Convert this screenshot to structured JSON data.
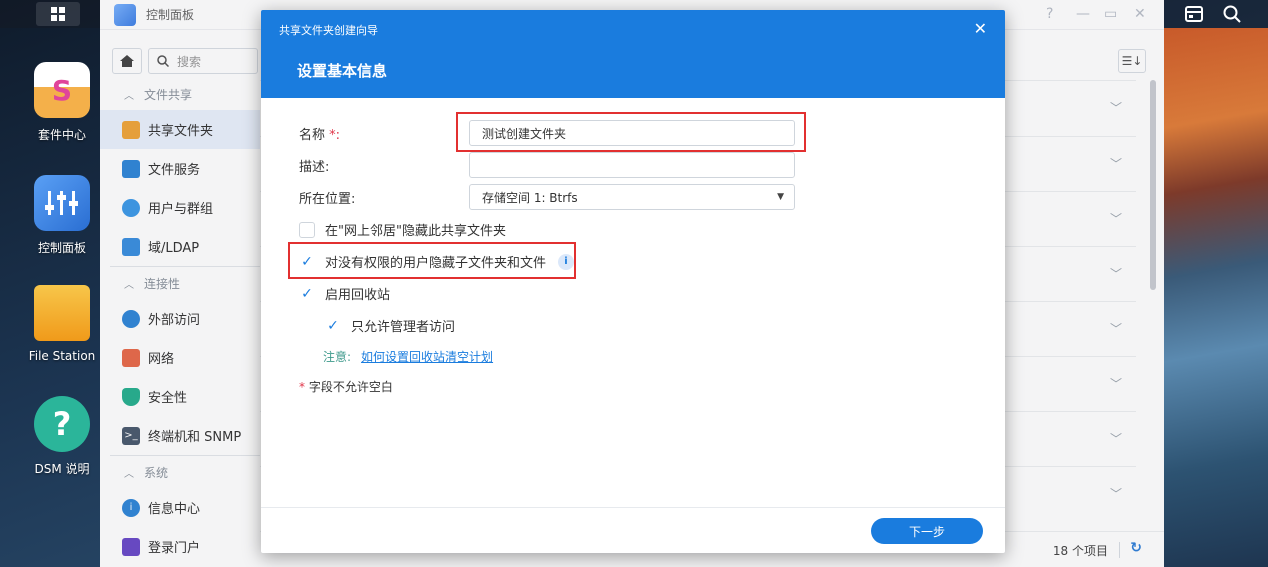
{
  "desktop": {
    "icons": [
      {
        "label": "套件中心",
        "icon": "package-center-icon"
      },
      {
        "label": "控制面板",
        "icon": "control-panel-icon"
      },
      {
        "label": "File Station",
        "icon": "folder-icon"
      },
      {
        "label": "DSM 说明",
        "icon": "help-icon"
      }
    ]
  },
  "control_panel": {
    "title": "控制面板",
    "search_placeholder": "搜索",
    "sections": [
      {
        "header": "文件共享",
        "items": [
          "共享文件夹",
          "文件服务",
          "用户与群组",
          "域/LDAP"
        ]
      },
      {
        "header": "连接性",
        "items": [
          "外部访问",
          "网络",
          "安全性",
          "终端机和 SNMP"
        ]
      },
      {
        "header": "系统",
        "items": [
          "信息中心",
          "登录门户"
        ]
      }
    ],
    "status": {
      "count": "18 个项目"
    }
  },
  "dialog": {
    "window_title": "共享文件夹创建向导",
    "step_title": "设置基本信息",
    "name_label": "名称",
    "name_required_mark": "*:",
    "name_value": "测试创建文件夹",
    "desc_label": "描述:",
    "desc_value": "",
    "location_label": "所在位置:",
    "location_value": "存储空间 1:  Btrfs",
    "cb_hide_network": "在\"网上邻居\"隐藏此共享文件夹",
    "cb_hide_subfolders": "对没有权限的用户隐藏子文件夹和文件",
    "cb_recycle_bin": "启用回收站",
    "cb_admin_only": "只允许管理者访问",
    "note_label": "注意:",
    "note_link": "如何设置回收站清空计划",
    "required_note_mark": "*",
    "required_note": "字段不允许空白",
    "next_button": "下一步"
  },
  "colors": {
    "accent": "#1a7cde",
    "highlight_box": "#e23030"
  }
}
